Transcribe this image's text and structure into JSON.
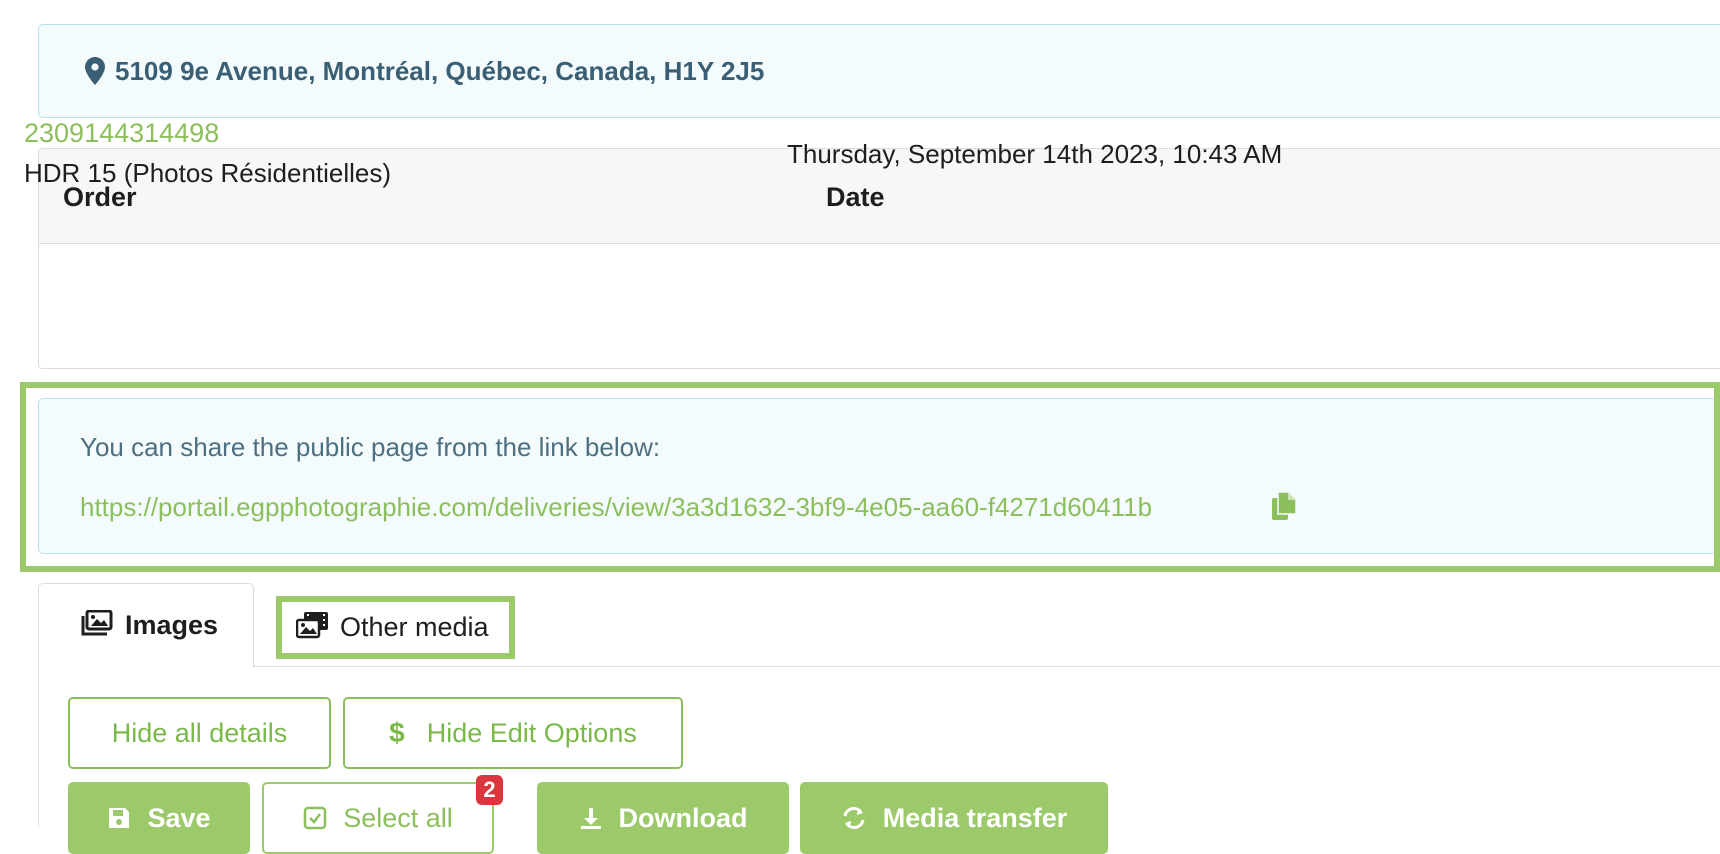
{
  "address": {
    "icon": "map-marker-icon",
    "text": "5109 9e Avenue, Montréal, Québec, Canada, H1Y 2J5"
  },
  "order_table": {
    "headers": [
      "Order",
      "Date"
    ],
    "row": {
      "order_id": "2309144314498",
      "description": "HDR 15 (Photos Résidentielles)",
      "date": "Thursday, September 14th 2023, 10:43 AM"
    }
  },
  "share": {
    "text": "You can share the public page from the link below:",
    "link": "https://portail.egpphotographie.com/deliveries/view/3a3d1632-3bf9-4e05-aa60-f4271d60411b",
    "copy_icon": "copy-icon"
  },
  "tabs": [
    {
      "label": "Images",
      "icon": "images-icon",
      "active": true
    },
    {
      "label": "Other media",
      "icon": "photo-film-icon",
      "active": false
    }
  ],
  "buttons": {
    "hide_details": "Hide all details",
    "hide_edit": "Hide Edit Options",
    "save": "Save",
    "select_all": "Select all",
    "select_all_badge": "2",
    "download": "Download",
    "media_transfer": "Media transfer"
  },
  "colors": {
    "accent_green": "#9cc96a",
    "link_green": "#8cbf5c",
    "info_bg": "#f3fbfd",
    "info_text": "#3a5f74",
    "badge_red": "#d9363e"
  }
}
